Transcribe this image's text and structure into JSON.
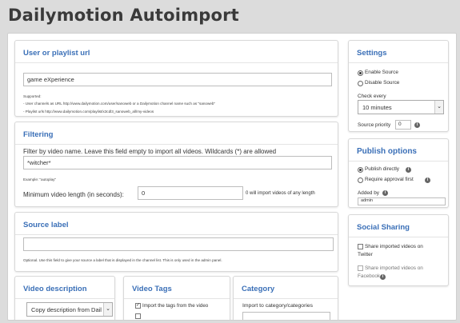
{
  "page": {
    "title": "Dailymotion Autoimport"
  },
  "source_url": {
    "heading": "User or playlist url",
    "value": "game eXperience",
    "help_title": "Supported:",
    "help_line1": "- User channels as URL http://www.dailymotion.com/user/sanoweb or a Dailymotion channel name such as \"sanoweb\"",
    "help_line2": "- Playlist urls http://www.dailymotion.com/playlist/x3cdl3_sanoweb_all/my-videos"
  },
  "filtering": {
    "heading": "Filtering",
    "filter_label": "Filter by video name. Leave this field empty to import all videos. Wildcards (*) are allowed",
    "filter_value": "*witcher*",
    "example": "Example: \"autoplay\"",
    "min_length_label": "Minimum video length (in seconds):",
    "min_length_value": "0",
    "min_length_hint": "0 will import videos of any length"
  },
  "source_label": {
    "heading": "Source label",
    "value": "",
    "help": "Optional. Use this field to give your source a label that is displayed in the channel list. This is only used in the admin panel."
  },
  "video_description": {
    "heading": "Video description",
    "selected": "Copy description from Dail"
  },
  "video_tags": {
    "heading": "Video Tags",
    "import_tags_label": "Import the tags from the video",
    "import_tags_checked": true
  },
  "category": {
    "heading": "Category",
    "label": "Import to category/categories"
  },
  "settings": {
    "heading": "Settings",
    "enable_label": "Enable Source",
    "disable_label": "Disable Source",
    "enabled": true,
    "check_every_label": "Check every",
    "check_every_value": "10 minutes",
    "priority_label": "Source priority",
    "priority_value": "0"
  },
  "publish": {
    "heading": "Publish options",
    "directly_label": "Publish directly",
    "approval_label": "Require approval first",
    "publish_directly": true,
    "added_by_label": "Added by",
    "added_by_value": "admin"
  },
  "social": {
    "heading": "Social Sharing",
    "twitter_line1": "Share imported videos on",
    "twitter_line2": "Twitter",
    "facebook_line1": "Share imported videos on",
    "facebook_line2": "Facebook"
  },
  "icons": {
    "info": "info-icon",
    "dropdown": "chevron-down-icon",
    "check": "checkmark-icon"
  }
}
